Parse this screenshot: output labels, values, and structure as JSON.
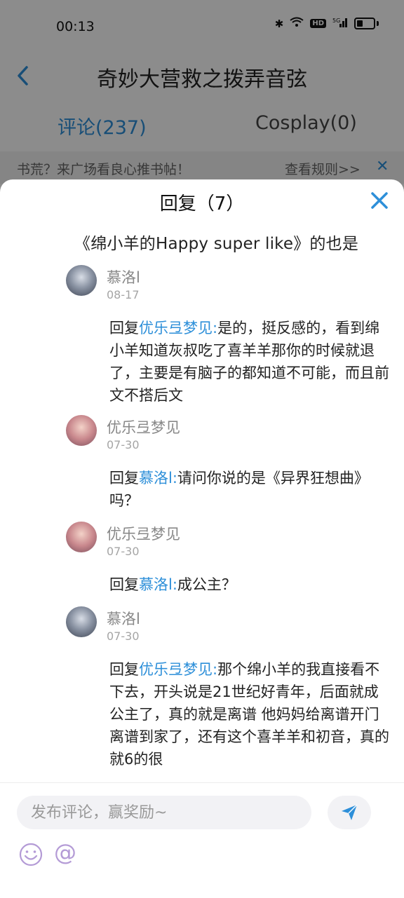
{
  "status_bar": {
    "time": "00:13",
    "icons": [
      "bluetooth-icon",
      "wifi-icon",
      "hd-icon",
      "5g-signal-icon",
      "battery-icon"
    ]
  },
  "nav": {
    "title": "奇妙大营救之拨弄音弦"
  },
  "tabs": [
    {
      "label": "评论(237)",
      "active": true
    },
    {
      "label": "Cosplay(0)",
      "active": false
    }
  ],
  "banner": {
    "text": "书荒？来广场看良心推书帖！",
    "link": "查看规则>>"
  },
  "sheet": {
    "title": "回复（7）",
    "original_comment": "《绵小羊的Happy super like》的也是"
  },
  "replies": [
    {
      "username": "慕洛l",
      "date": "08-17",
      "prefix": "回复",
      "mention": "优乐弖梦见:",
      "text": "是的，挺反感的，看到绵小羊知道灰叔吃了喜羊羊那你的时候就退了，主要是有脑子的都知道不可能，而且前文不搭后文"
    },
    {
      "username": "优乐弖梦见",
      "date": "07-30",
      "prefix": "回复",
      "mention": "慕洛l:",
      "text": "请问你说的是《异界狂想曲》吗？"
    },
    {
      "username": "优乐弖梦见",
      "date": "07-30",
      "prefix": "回复",
      "mention": "慕洛l:",
      "text": "成公主？"
    },
    {
      "username": "慕洛l",
      "date": "07-30",
      "prefix": "回复",
      "mention": "优乐弖梦见:",
      "text": "那个绵小羊的我直接看不下去，开头说是21世纪好青年，后面就成公主了，真的就是离谱 他妈妈给离谱开门 离谱到家了，还有这个喜羊羊和初音，真的就6的很"
    }
  ],
  "input": {
    "placeholder": "发布评论，赢奖励~",
    "value": "",
    "at_label": "@"
  },
  "colors": {
    "accent": "#2d8fd9",
    "overlay": "rgba(0,0,0,0.45)"
  }
}
